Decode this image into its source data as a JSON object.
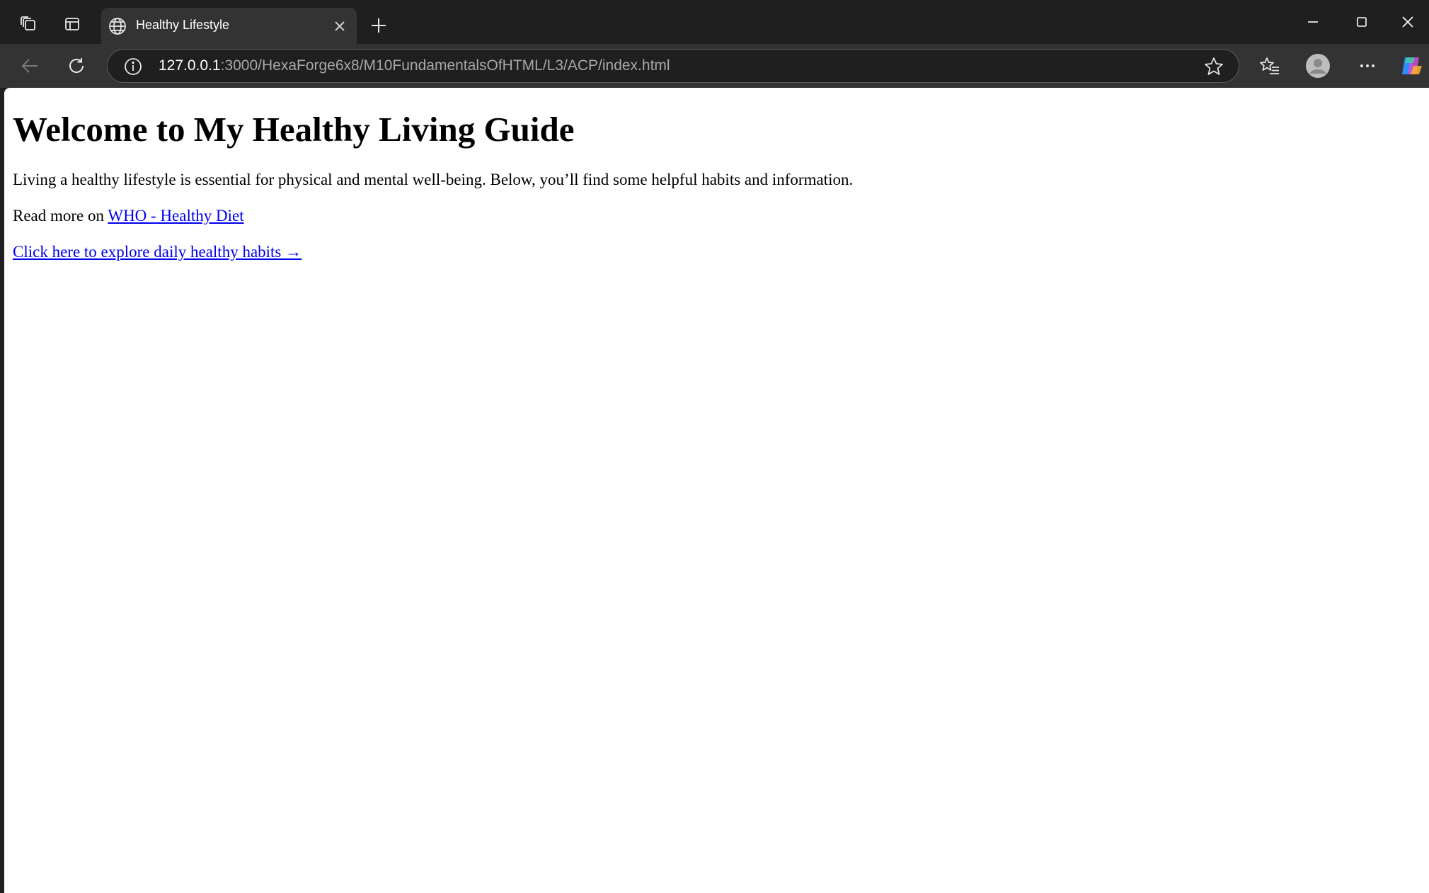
{
  "browser": {
    "tab": {
      "title": "Healthy Lifestyle"
    },
    "address_bar": {
      "host": "127.0.0.1",
      "rest": ":3000/HexaForge6x8/M10FundamentalsOfHTML/L3/ACP/index.html"
    },
    "icons": {
      "workspaces": "workspaces-icon",
      "tab_actions": "vertical-tabs-icon",
      "favicon": "globe-icon",
      "close_tab": "close-icon",
      "new_tab": "plus-icon",
      "minimize": "minimize-icon",
      "maximize": "maximize-icon",
      "close_window": "close-icon",
      "back": "back-arrow-icon",
      "refresh": "refresh-icon",
      "site_info": "info-icon",
      "favorite": "star-icon",
      "favorites_hub": "favorites-icon",
      "profile": "avatar-icon",
      "more": "more-icon",
      "copilot": "copilot-icon"
    },
    "colors": {
      "frame": "#1f1f1f",
      "toolbar": "#333333",
      "active_tab": "#333333",
      "link": "#0000ee"
    }
  },
  "page": {
    "heading": "Welcome to My Healthy Living Guide",
    "intro": "Living a healthy lifestyle is essential for physical and mental well-being. Below, you’ll find some helpful habits and information.",
    "read_more_prefix": "Read more on ",
    "read_more_link": "WHO - Healthy Diet",
    "habits_link": "Click here to explore daily healthy habits →"
  }
}
